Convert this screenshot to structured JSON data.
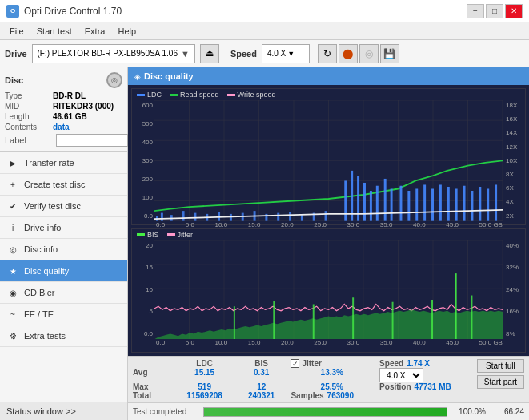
{
  "titlebar": {
    "title": "Opti Drive Control 1.70",
    "icon_label": "O",
    "minimize": "−",
    "maximize": "□",
    "close": "✕"
  },
  "menubar": {
    "items": [
      "File",
      "Start test",
      "Extra",
      "Help"
    ]
  },
  "drivebar": {
    "label": "Drive",
    "drive_name": "(F:)  PLEXTOR BD-R  PX-LB950SA 1.06",
    "speed_label": "Speed",
    "speed_value": "4.0 X"
  },
  "disc": {
    "header": "Disc",
    "type_label": "Type",
    "type_val": "BD-R DL",
    "mid_label": "MID",
    "mid_val": "RITEKDR3 (000)",
    "length_label": "Length",
    "length_val": "46.61 GB",
    "contents_label": "Contents",
    "contents_val": "data",
    "label_label": "Label",
    "label_val": ""
  },
  "nav": {
    "items": [
      {
        "id": "transfer-rate",
        "label": "Transfer rate",
        "icon": "▶"
      },
      {
        "id": "create-test-disc",
        "label": "Create test disc",
        "icon": "+"
      },
      {
        "id": "verify-test-disc",
        "label": "Verify test disc",
        "icon": "✔"
      },
      {
        "id": "drive-info",
        "label": "Drive info",
        "icon": "i"
      },
      {
        "id": "disc-info",
        "label": "Disc info",
        "icon": "💿"
      },
      {
        "id": "disc-quality",
        "label": "Disc quality",
        "icon": "★",
        "active": true
      },
      {
        "id": "cd-bier",
        "label": "CD Bier",
        "icon": "🍺"
      },
      {
        "id": "fe-te",
        "label": "FE / TE",
        "icon": "~"
      },
      {
        "id": "extra-tests",
        "label": "Extra tests",
        "icon": "⚙"
      }
    ]
  },
  "status_window": {
    "label": "Status window >>",
    "arrows": ""
  },
  "chart": {
    "header": "Disc quality",
    "top": {
      "legend": [
        {
          "id": "ldc",
          "label": "LDC",
          "color_class": "blue"
        },
        {
          "id": "read-speed",
          "label": "Read speed",
          "color_class": "green"
        },
        {
          "id": "write-speed",
          "label": "Write speed",
          "color_class": "pink"
        }
      ],
      "y_left_max": 600,
      "y_right_labels": [
        "18X",
        "16X",
        "14X",
        "12X",
        "10X",
        "8X",
        "6X",
        "4X",
        "2X"
      ],
      "x_labels": [
        "0.0",
        "5.0",
        "10.0",
        "15.0",
        "20.0",
        "25.0",
        "30.0",
        "35.0",
        "40.0",
        "45.0",
        "50.0 GB"
      ]
    },
    "bottom": {
      "legend": [
        {
          "id": "bis",
          "label": "BIS",
          "color_class": "green2"
        },
        {
          "id": "jitter",
          "label": "Jitter",
          "color_class": "pink"
        }
      ],
      "y_left_max": 20,
      "y_right_labels": [
        "40%",
        "32%",
        "24%",
        "16%",
        "8%"
      ],
      "x_labels": [
        "0.0",
        "5.0",
        "10.0",
        "15.0",
        "20.0",
        "25.0",
        "30.0",
        "35.0",
        "40.0",
        "45.0",
        "50.0 GB"
      ]
    }
  },
  "stats": {
    "col_headers": [
      "LDC",
      "BIS",
      "",
      "Jitter",
      "Speed",
      ""
    ],
    "avg_label": "Avg",
    "avg_ldc": "15.15",
    "avg_bis": "0.31",
    "avg_jitter": "13.3%",
    "avg_speed_val": "1.74 X",
    "avg_speed_select": "4.0 X",
    "max_label": "Max",
    "max_ldc": "519",
    "max_bis": "12",
    "max_jitter": "25.5%",
    "position_label": "Position",
    "position_val": "47731 MB",
    "total_label": "Total",
    "total_ldc": "11569208",
    "total_bis": "240321",
    "samples_label": "Samples",
    "samples_val": "763090",
    "jitter_checked": true,
    "start_full": "Start full",
    "start_part": "Start part"
  },
  "progress": {
    "status_text": "Test completed",
    "percent": 100,
    "percent_display": "100.0%",
    "time_display": "66.24"
  }
}
